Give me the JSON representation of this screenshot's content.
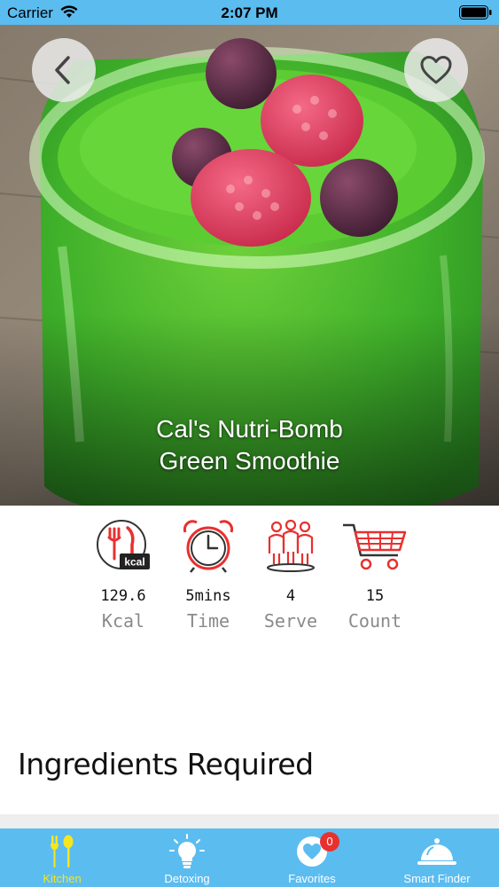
{
  "status_bar": {
    "carrier": "Carrier",
    "time": "2:07 PM"
  },
  "hero": {
    "title_line1": "Cal's Nutri-Bomb",
    "title_line2": "Green Smoothie",
    "back_icon": "chevron-left-icon",
    "favorite_icon": "heart-outline-icon"
  },
  "stats": [
    {
      "icon": "kcal-icon",
      "value": "129.6",
      "label": "Kcal"
    },
    {
      "icon": "alarm-clock-icon",
      "value": "5mins",
      "label": "Time"
    },
    {
      "icon": "people-icon",
      "value": "4",
      "label": "Serve"
    },
    {
      "icon": "shopping-cart-icon",
      "value": "15",
      "label": "Count"
    }
  ],
  "ingredients_title": "Ingredients Required",
  "tab_bar": {
    "tabs": [
      {
        "label": "Kitchen",
        "icon": "utensils-icon",
        "active": true
      },
      {
        "label": "Detoxing",
        "icon": "lightbulb-icon",
        "active": false
      },
      {
        "label": "Favorites",
        "icon": "heart-icon",
        "active": false,
        "badge": "0"
      },
      {
        "label": "Smart Finder",
        "icon": "cloche-icon",
        "active": false
      }
    ]
  },
  "colors": {
    "accent": "#5bbcf0",
    "active_tab": "#f5e61f",
    "badge": "#e8302f",
    "icon_red": "#e8302f"
  }
}
